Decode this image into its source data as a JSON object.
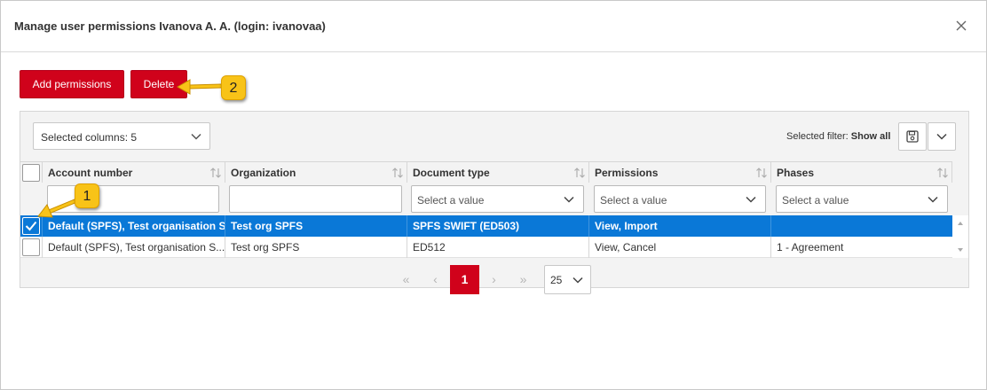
{
  "dialog": {
    "title": "Manage user permissions Ivanova A. A. (login: ivanovaa)"
  },
  "toolbar": {
    "add_label": "Add permissions",
    "delete_label": "Delete"
  },
  "grid": {
    "columns_select": "Selected columns: 5",
    "filter_prefix": "Selected filter:",
    "filter_value": "Show all",
    "headers": [
      "Account number",
      "Organization",
      "Document type",
      "Permissions",
      "Phases"
    ],
    "filter_placeholder": "Select a value",
    "rows": [
      {
        "selected": true,
        "account": "Default (SPFS), Test organisation S...",
        "organization": "Test org SPFS",
        "doc_type": "SPFS SWIFT (ED503)",
        "permissions": "View, Import",
        "phases": ""
      },
      {
        "selected": false,
        "account": "Default (SPFS), Test organisation S...",
        "organization": "Test org SPFS",
        "doc_type": "ED512",
        "permissions": "View, Cancel",
        "phases": "1 - Agreement"
      }
    ]
  },
  "pager": {
    "first": "«",
    "prev": "‹",
    "current_page": "1",
    "next": "›",
    "last": "»",
    "page_size": "25"
  },
  "callouts": {
    "one": "1",
    "two": "2"
  },
  "colors": {
    "accent": "#d0021b",
    "selection": "#0a78d7",
    "callout": "#f8c318"
  }
}
